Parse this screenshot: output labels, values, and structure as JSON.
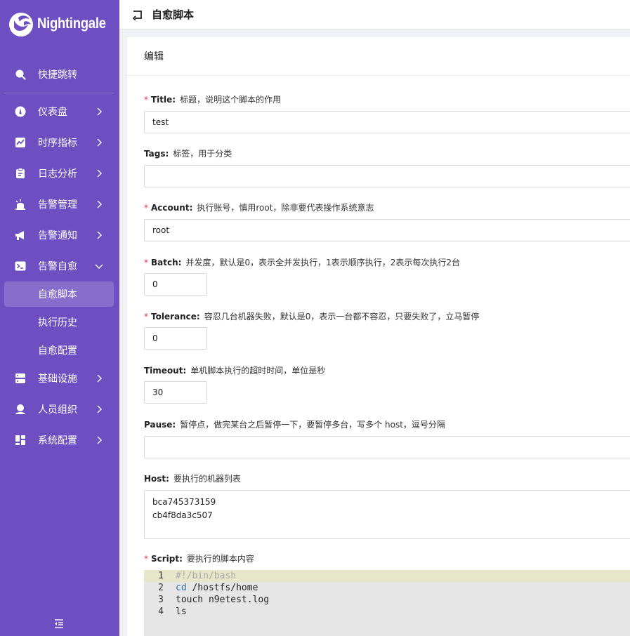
{
  "app": {
    "logo_text": "Nightingale"
  },
  "header": {
    "title": "自愈脚本"
  },
  "sidebar": {
    "items": [
      {
        "label": "快捷跳转",
        "icon": "search-icon"
      },
      {
        "label": "仪表盘",
        "icon": "dashboard-icon"
      },
      {
        "label": "时序指标",
        "icon": "line-chart-icon"
      },
      {
        "label": "日志分析",
        "icon": "clipboard-icon"
      },
      {
        "label": "告警管理",
        "icon": "alarm-bell-icon"
      },
      {
        "label": "告警通知",
        "icon": "megaphone-icon"
      },
      {
        "label": "告警自愈",
        "icon": "terminal-icon"
      },
      {
        "label": "基础设施",
        "icon": "server-icon"
      },
      {
        "label": "人员组织",
        "icon": "user-icon"
      },
      {
        "label": "系统配置",
        "icon": "grid-icon"
      }
    ],
    "sub_items": [
      {
        "label": "自愈脚本",
        "active": true
      },
      {
        "label": "执行历史",
        "active": false
      },
      {
        "label": "自愈配置",
        "active": false
      }
    ]
  },
  "form": {
    "card_title": "编辑",
    "title": {
      "key": "Title:",
      "desc": "标题，说明这个脚本的作用",
      "value": "test",
      "required": true
    },
    "tags": {
      "key": "Tags:",
      "desc": "标签，用于分类",
      "value": "",
      "required": false
    },
    "account": {
      "key": "Account:",
      "desc": "执行账号，慎用root，除非要代表操作系统意志",
      "value": "root",
      "required": true
    },
    "batch": {
      "key": "Batch:",
      "desc": "并发度，默认是0，表示全并发执行，1表示顺序执行，2表示每次执行2台",
      "value": "0",
      "required": true
    },
    "tolerance": {
      "key": "Tolerance:",
      "desc": "容忍几台机器失败，默认是0，表示一台都不容忍，只要失败了，立马暂停",
      "value": "0",
      "required": true
    },
    "timeout": {
      "key": "Timeout:",
      "desc": "单机脚本执行的超时时间，单位是秒",
      "value": "30",
      "required": false
    },
    "pause": {
      "key": "Pause:",
      "desc": "暂停点，做完某台之后暂停一下，要暂停多台，写多个 host，逗号分隔",
      "value": "",
      "required": false
    },
    "host": {
      "key": "Host:",
      "desc": "要执行的机器列表",
      "lines": [
        "bca745373159",
        "cb4f8da3c507"
      ],
      "required": false
    },
    "script": {
      "key": "Script:",
      "desc": "要执行的脚本内容",
      "required": true,
      "lines": [
        {
          "num": "1",
          "text": "#!/bin/bash"
        },
        {
          "num": "2",
          "kw": "cd",
          "text": " /hostfs/home"
        },
        {
          "num": "3",
          "text": "touch n9etest.log"
        },
        {
          "num": "4",
          "text": "ls"
        }
      ]
    }
  },
  "colors": {
    "sidebar_bg": "#6d4fc2",
    "required_mark": "#e23c3c"
  }
}
